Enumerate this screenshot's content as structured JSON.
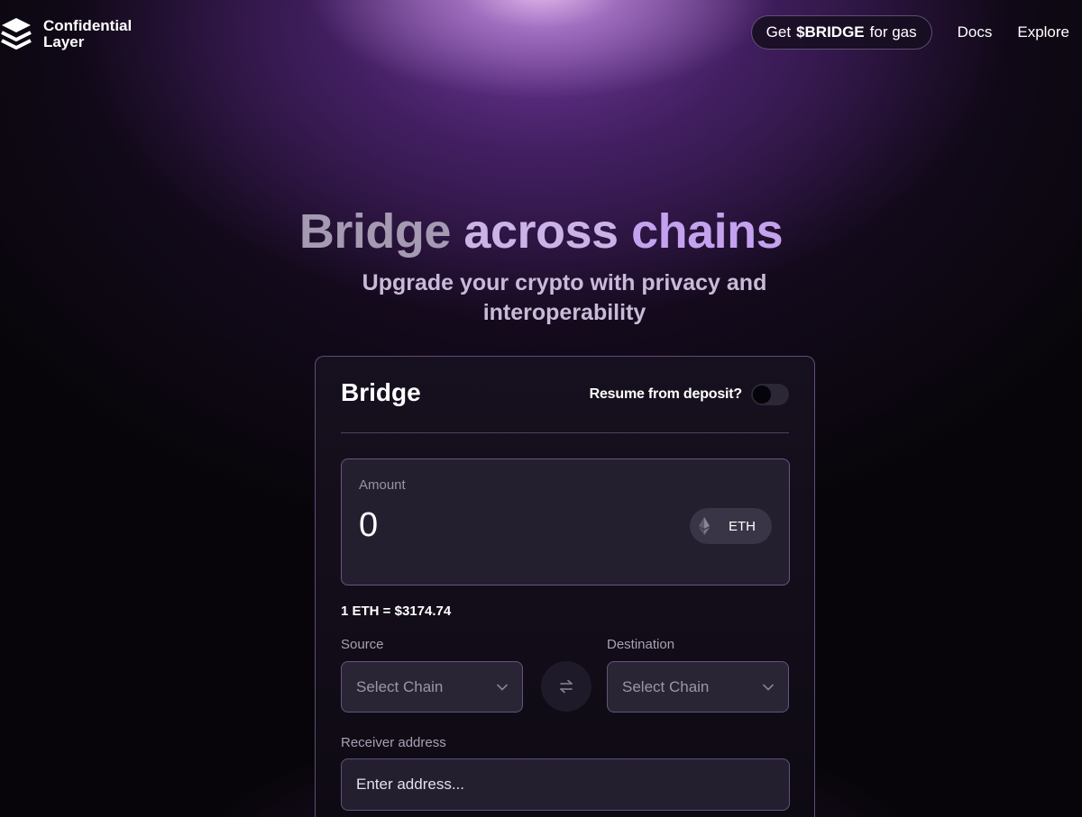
{
  "brand": {
    "logo_line1": "Confidential",
    "logo_line2": "Layer",
    "logo_icon": "stacked-layers-icon"
  },
  "nav": {
    "gas_prefix": "Get",
    "gas_token": "$BRIDGE",
    "gas_suffix": "for gas",
    "docs": "Docs",
    "explore": "Explore"
  },
  "hero": {
    "title_word1": "Bridge",
    "title_word2": "across",
    "title_word3": "chains",
    "subtitle": "Upgrade your crypto with privacy and interoperability"
  },
  "bridge_card": {
    "title": "Bridge",
    "resume_label": "Resume from deposit?",
    "resume_toggle_on": false,
    "amount": {
      "label": "Amount",
      "value": "0",
      "token": "ETH",
      "token_icon": "ethereum-icon"
    },
    "rate": "1 ETH = $3174.74",
    "source": {
      "label": "Source",
      "value": "Select Chain"
    },
    "destination": {
      "label": "Destination",
      "value": "Select Chain"
    },
    "swap_icon": "swap-arrows-icon",
    "receiver": {
      "label": "Receiver address",
      "placeholder": "Enter address..."
    }
  },
  "colors": {
    "background": "#070509",
    "glow": "#c79be6",
    "card_border": "#a082c8",
    "field_background": "#241f2f"
  }
}
